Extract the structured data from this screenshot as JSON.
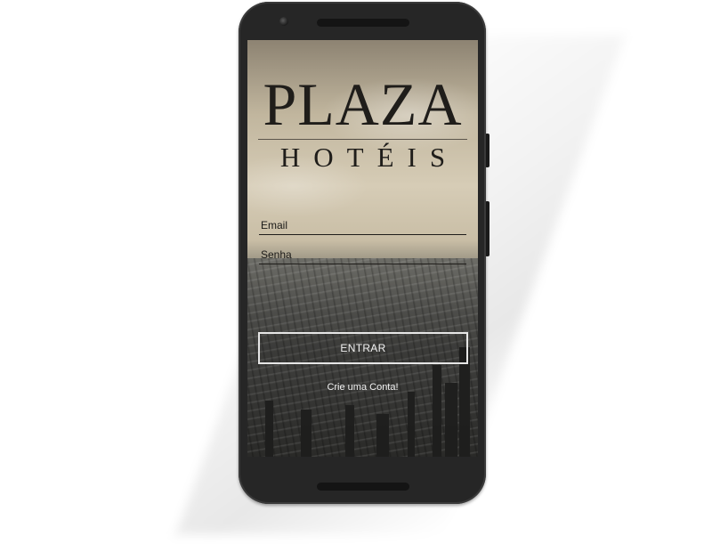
{
  "app": {
    "logo_title": "PLAZA",
    "logo_subtitle": "HOTÉIS"
  },
  "form": {
    "email_label": "Email",
    "password_label": "Senha"
  },
  "actions": {
    "login_label": "ENTRAR",
    "create_account_label": "Crie uma Conta!"
  },
  "colors": {
    "phone_body": "#262626",
    "logo_text": "#1f1d1a",
    "button_border": "#e6e6e6"
  }
}
